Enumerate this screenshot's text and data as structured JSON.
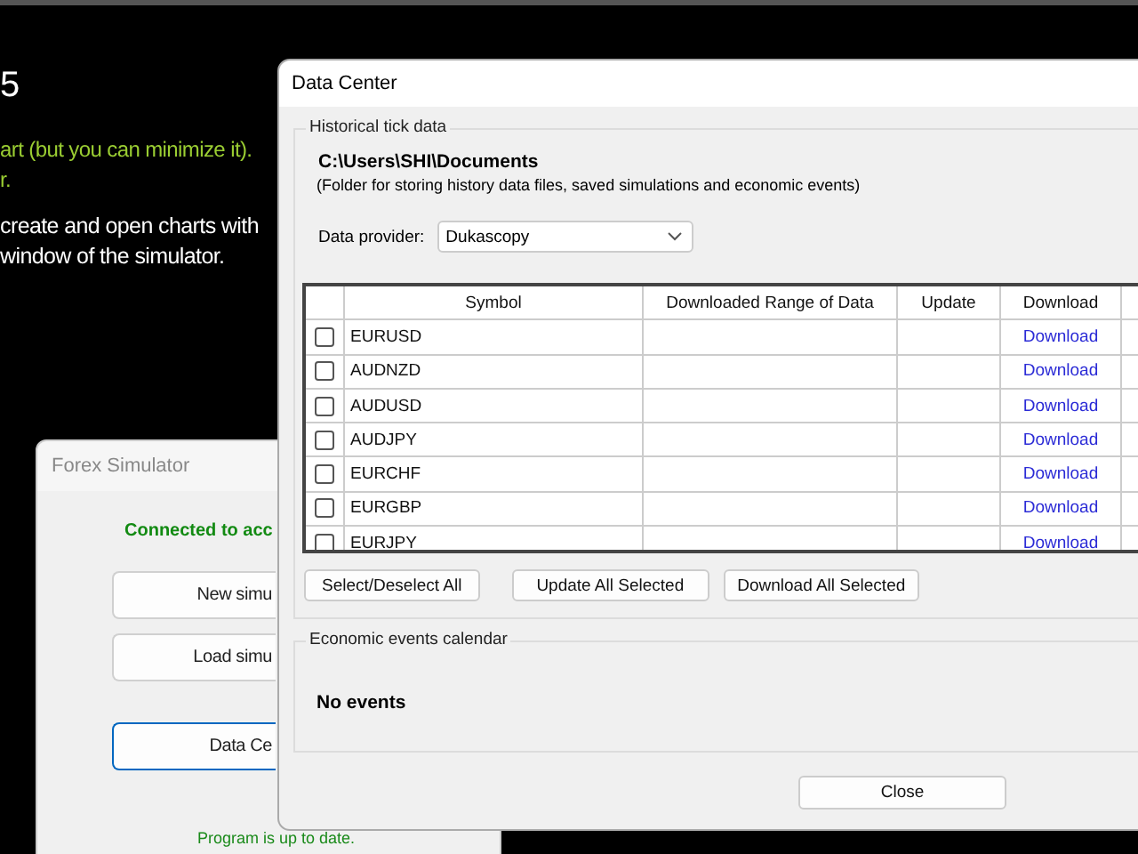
{
  "background_text": [
    {
      "text": "5",
      "kind": "heading"
    },
    {
      "text": "art (but you can minimize it).",
      "kind": "note"
    },
    {
      "text": "r.",
      "kind": "note"
    },
    {
      "text": "create and open charts with",
      "kind": "body"
    },
    {
      "text": "window of the simulator.",
      "kind": "body"
    }
  ],
  "forex_simulator": {
    "title": "Forex Simulator",
    "status": "Connected to acc",
    "buttons": [
      {
        "label": "New simu",
        "focused": false
      },
      {
        "label": "Load simu",
        "focused": false
      },
      {
        "label": "Data Ce",
        "focused": true
      }
    ],
    "footer": "Program is up to date."
  },
  "data_center": {
    "title": "Data Center",
    "historical_group": {
      "title": "Historical tick data",
      "folder_path": "C:\\Users\\SHI\\Documents",
      "folder_note": "(Folder for storing history data files, saved simulations and economic events)",
      "provider_label": "Data provider:",
      "provider_value": "Dukascopy",
      "table": {
        "columns": [
          "Symbol",
          "Downloaded Range of Data",
          "Update",
          "Download"
        ],
        "rows": [
          {
            "checked": false,
            "symbol": "EURUSD",
            "download": "Download"
          },
          {
            "checked": false,
            "symbol": "AUDNZD",
            "download": "Download"
          },
          {
            "checked": false,
            "symbol": "AUDUSD",
            "download": "Download"
          },
          {
            "checked": false,
            "symbol": "AUDJPY",
            "download": "Download"
          },
          {
            "checked": false,
            "symbol": "EURCHF",
            "download": "Download"
          },
          {
            "checked": false,
            "symbol": "EURGBP",
            "download": "Download"
          },
          {
            "checked": false,
            "symbol": "EURJPY",
            "download": "Download"
          }
        ]
      },
      "buttons": [
        "Select/Deselect All",
        "Update All Selected",
        "Download All Selected"
      ]
    },
    "events_group": {
      "title": "Economic events calendar",
      "message": "No events"
    },
    "close_button": "Close"
  }
}
